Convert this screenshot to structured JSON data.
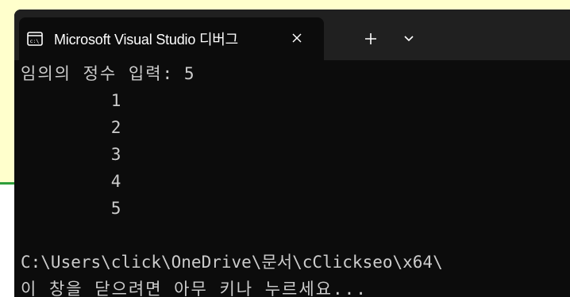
{
  "tab": {
    "title": "Microsoft Visual Studio 디버그",
    "icon": "terminal-icon"
  },
  "console": {
    "prompt_label": "임의의 정수 입력:",
    "prompt_value": "5",
    "outputs": [
      "1",
      "2",
      "3",
      "4",
      "5"
    ],
    "path_line": "C:\\Users\\click\\OneDrive\\문서\\cClickseo\\x64\\",
    "exit_message": "이 창을 닫으려면 아무 키나 누르세요..."
  },
  "colors": {
    "background": "#0c0c0c",
    "titlebar": "#202020",
    "text": "#cccccc",
    "page_yellow": "#ffffcc",
    "accent_green": "#2e9d3a"
  }
}
